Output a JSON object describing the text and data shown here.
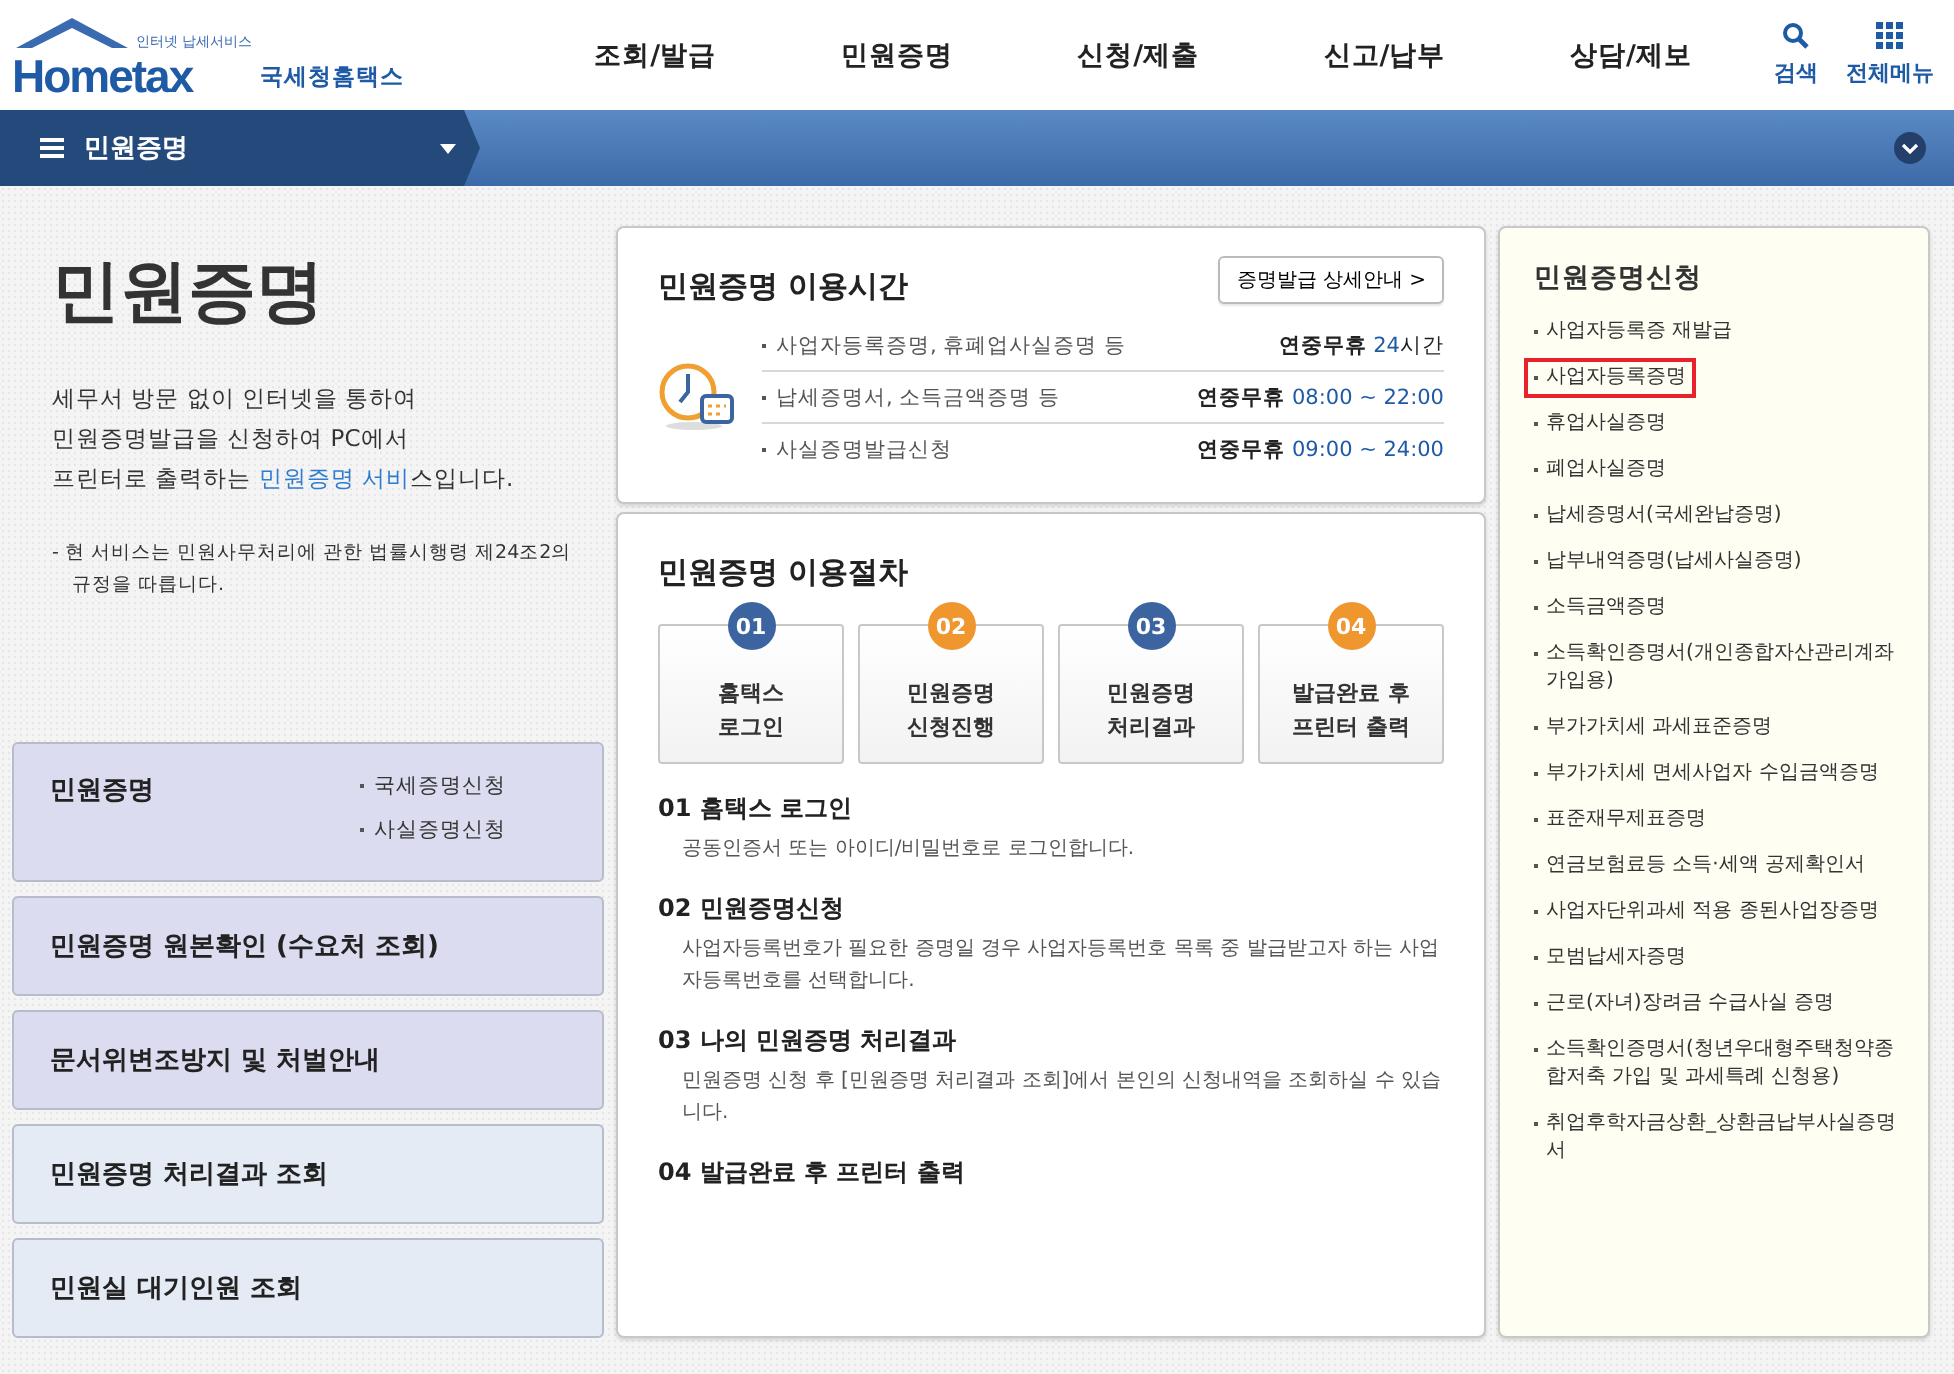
{
  "logo": {
    "tagline": "인터넷 납세서비스",
    "wordmark": "Hometax",
    "name": "국세청홈택스"
  },
  "main_menu": [
    "조회/발급",
    "민원증명",
    "신청/제출",
    "신고/납부",
    "상담/제보"
  ],
  "header_tools": [
    {
      "kind": "search",
      "label": "검색"
    },
    {
      "kind": "grid",
      "label": "전체메뉴"
    }
  ],
  "breadcrumb": {
    "label": "민원증명"
  },
  "intro": {
    "title": "민원증명",
    "lines": [
      "세무서 방문 없이 인터넷을 통하여",
      "민원증명발급을 신청하여 PC에서"
    ],
    "last_line": {
      "before": "프린터로 출력하는 ",
      "link": "민원증명 서비",
      "after": "스입니다."
    },
    "note": "- 현 서비스는 민원사무처리에 관한 법률시행령 제24조2의 규정을 따릅니다."
  },
  "side_menu": [
    {
      "label": "민원증명",
      "color": "#dcdcf0",
      "sub": [
        "국세증명신청",
        "사실증명신청"
      ]
    },
    {
      "label": "민원증명 원본확인 (수요처 조회)",
      "color": "#dcdcf0"
    },
    {
      "label": "문서위변조방지 및 처벌안내",
      "color": "#dcdcf0"
    },
    {
      "label": "민원증명 처리결과 조회",
      "color": "#e4ebf4"
    },
    {
      "label": "민원실 대기인원 조회",
      "color": "#e4ebf4"
    }
  ],
  "hours": {
    "title": "민원증명 이용시간",
    "detail_button": "증명발급 상세안내 >",
    "rows": [
      {
        "label": "사업자등록증명, 휴폐업사실증명 등",
        "days": "연중무휴",
        "hours": "24",
        "suffix": "시간"
      },
      {
        "label": "납세증명서, 소득금액증명 등",
        "days": "연중무휴",
        "hours": "08:00 ~ 22:00"
      },
      {
        "label": "사실증명발급신청",
        "days": "연중무휴",
        "hours": "09:00 ~ 24:00"
      }
    ]
  },
  "procedure": {
    "title": "민원증명 이용절차",
    "steps": [
      {
        "number": "01",
        "color": "#3b64a0",
        "label": "홈택스\n로그인"
      },
      {
        "number": "02",
        "color": "#f0962e",
        "label": "민원증명\n신청진행"
      },
      {
        "number": "03",
        "color": "#3b64a0",
        "label": "민원증명\n처리결과"
      },
      {
        "number": "04",
        "color": "#f0962e",
        "label": "발급완료 후\n프린터 출력"
      }
    ],
    "details": [
      {
        "title": "01 홈택스 로그인",
        "text": "공동인증서 또는 아이디/비밀번호로 로그인합니다."
      },
      {
        "title": "02 민원증명신청",
        "text": "사업자등록번호가 필요한 증명일 경우 사업자등록번호 목록 중 발급받고자 하는 사업자등록번호를 선택합니다."
      },
      {
        "title": "03 나의 민원증명 처리결과",
        "text": "민원증명 신청 후 [민원증명 처리결과 조회]에서 본인의 신청내역을 조회하실 수 있습니다."
      },
      {
        "title": "04 발급완료 후 프린터 출력"
      }
    ]
  },
  "apply": {
    "title": "민원증명신청",
    "items": [
      {
        "label": "사업자등록증 재발급",
        "highlighted": false
      },
      {
        "label": "사업자등록증명",
        "highlighted": true
      },
      {
        "label": "휴업사실증명",
        "highlighted": false
      },
      {
        "label": "폐업사실증명",
        "highlighted": false
      },
      {
        "label": "납세증명서(국세완납증명)",
        "highlighted": false
      },
      {
        "label": "납부내역증명(납세사실증명)",
        "highlighted": false
      },
      {
        "label": "소득금액증명",
        "highlighted": false
      },
      {
        "label": "소득확인증명서(개인종합자산관리계좌 가입용)",
        "highlighted": false
      },
      {
        "label": "부가가치세 과세표준증명",
        "highlighted": false
      },
      {
        "label": "부가가치세 면세사업자 수입금액증명",
        "highlighted": false
      },
      {
        "label": "표준재무제표증명",
        "highlighted": false
      },
      {
        "label": "연금보험료등 소득·세액 공제확인서",
        "highlighted": false
      },
      {
        "label": "사업자단위과세 적용 종된사업장증명",
        "highlighted": false
      },
      {
        "label": "모범납세자증명",
        "highlighted": false
      },
      {
        "label": "근로(자녀)장려금 수급사실 증명",
        "highlighted": false
      },
      {
        "label": "소득확인증명서(청년우대형주택청약종합저축 가입 및 과세특례 신청용)",
        "highlighted": false
      },
      {
        "label": "취업후학자금상환_상환금납부사실증명서",
        "highlighted": false
      }
    ]
  }
}
